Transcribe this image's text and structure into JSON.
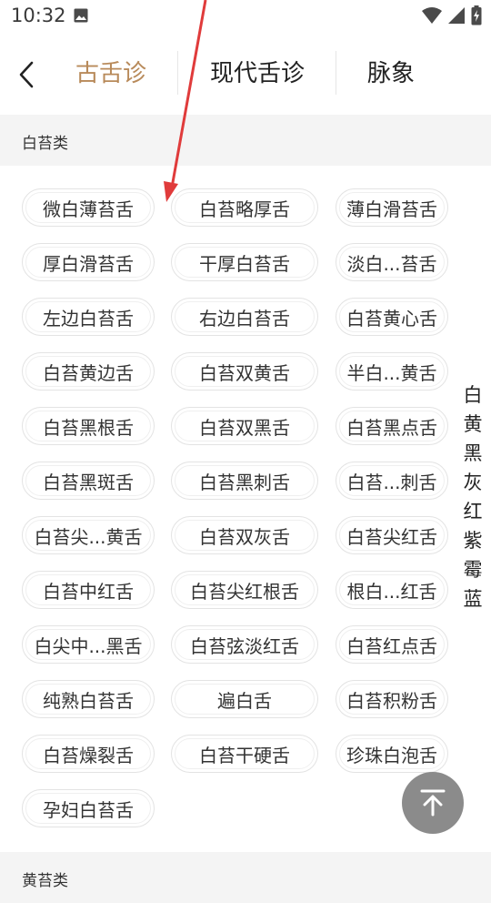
{
  "status_bar": {
    "time": "10:32"
  },
  "tabs": [
    {
      "label": "古舌诊",
      "active": true
    },
    {
      "label": "现代舌诊",
      "active": false
    },
    {
      "label": "脉象",
      "active": false
    }
  ],
  "sections": [
    {
      "title": "白苔类",
      "items": [
        "微白薄苔舌",
        "白苔略厚舌",
        "薄白滑苔舌",
        "厚白滑苔舌",
        "干厚白苔舌",
        "淡白...苔舌",
        "左边白苔舌",
        "右边白苔舌",
        "白苔黄心舌",
        "白苔黄边舌",
        "白苔双黄舌",
        "半白...黄舌",
        "白苔黑根舌",
        "白苔双黑舌",
        "白苔黑点舌",
        "白苔黑斑舌",
        "白苔黑刺舌",
        "白苔...刺舌",
        "白苔尖...黄舌",
        "白苔双灰舌",
        "白苔尖红舌",
        "白苔中红舌",
        "白苔尖红根舌",
        "根白...红舌",
        "白尖中...黑舌",
        "白苔弦淡红舌",
        "白苔红点舌",
        "纯熟白苔舌",
        "遍白舌",
        "白苔积粉舌",
        "白苔燥裂舌",
        "白苔干硬舌",
        "珍珠白泡舌",
        "孕妇白苔舌"
      ]
    },
    {
      "title": "黄苔类"
    }
  ],
  "side_index": [
    "白",
    "黄",
    "黑",
    "灰",
    "红",
    "紫",
    "霉",
    "蓝"
  ],
  "colors": {
    "accent": "#b88a5a",
    "fab": "#8b8b8b",
    "section_bg": "#f4f4f4",
    "annotation_arrow": "#e03b3b"
  },
  "icons": {
    "back": "chevron-left-icon",
    "fab": "scroll-to-top-icon",
    "status_image": "image-icon",
    "wifi": "wifi-icon",
    "signal": "signal-icon",
    "battery": "battery-charging-icon"
  }
}
